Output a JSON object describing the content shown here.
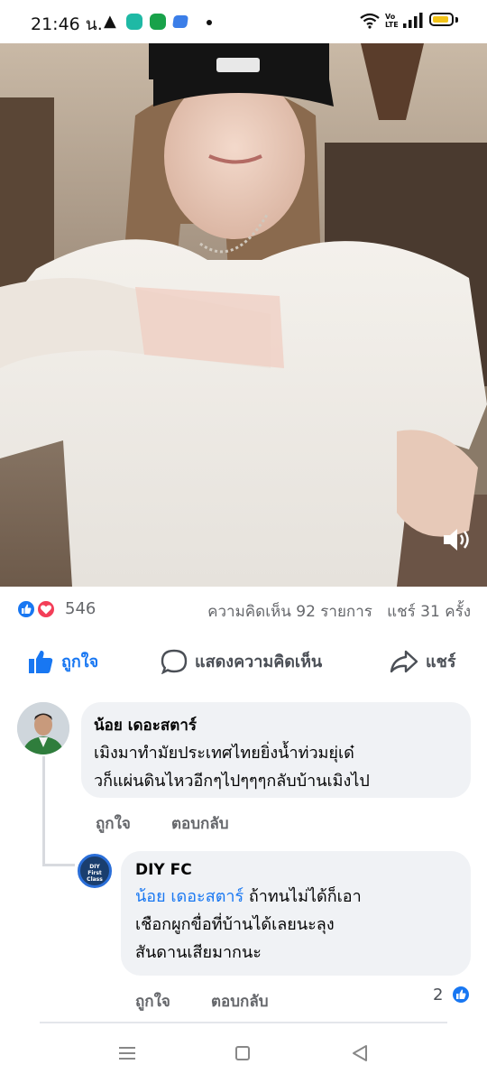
{
  "status_bar": {
    "time": "21:46 น.",
    "network_label": "Vo LTE"
  },
  "stats": {
    "reaction_count": "546",
    "comments": "ความคิดเห็น 92 รายการ",
    "shares": "แชร์ 31 ครั้ง"
  },
  "actions": {
    "like": "ถูกใจ",
    "comment": "แสดงความคิดเห็น",
    "share": "แชร์"
  },
  "comments": [
    {
      "author": "น้อย เดอะสตาร์",
      "lines": [
        "เมิงมาทำมัยประเทศไทยยิ่งน้ำท่วมยุ่เด๋",
        "วก็แผ่นดินไหวอีกๆไปๆๆๆกลับบ้านเมิงไป"
      ],
      "like_label": "ถูกใจ",
      "reply_label": "ตอบกลับ"
    },
    {
      "author": "DIY FC",
      "avatar_text": "DIY\nFirst\nClass",
      "mention": "น้อย เดอะสตาร์",
      "line1_rest": " ถ้าทนไม่ได้ก็เอา",
      "line2": "เชือกผูกขื่อที่บ้านได้เลยนะลุง",
      "line3": "สันดานเสียมากนะ",
      "like_label": "ถูกใจ",
      "reply_label": "ตอบกลับ",
      "like_count": "2"
    }
  ],
  "colors": {
    "facebook_blue": "#1877f2",
    "love_red": "#f33e58",
    "bubble_bg": "#f0f2f5",
    "muted_text": "#65676b"
  }
}
